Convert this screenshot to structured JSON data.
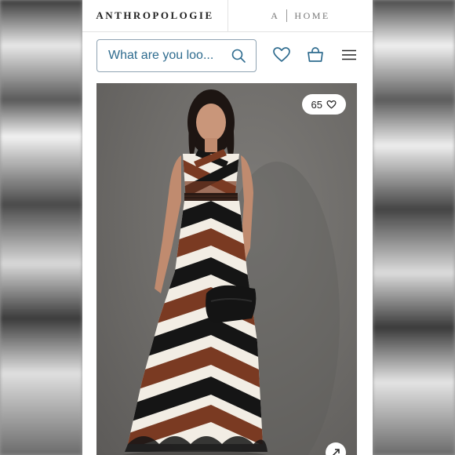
{
  "header": {
    "brand": "ANTHROPOLOGIE",
    "home_prefix": "A",
    "home_label": "HOME"
  },
  "search": {
    "placeholder": "What are you loo..."
  },
  "icons": {
    "search": "search-icon",
    "wishlist": "heart-icon",
    "bag": "shopping-bag-icon",
    "menu": "hamburger-menu-icon",
    "like": "heart-icon",
    "expand": "expand-arrow-icon"
  },
  "product": {
    "likes": "65"
  },
  "colors": {
    "accent": "#2f6c8f",
    "brown": "#7a3a22",
    "black": "#151515",
    "cream": "#f2ede4"
  }
}
